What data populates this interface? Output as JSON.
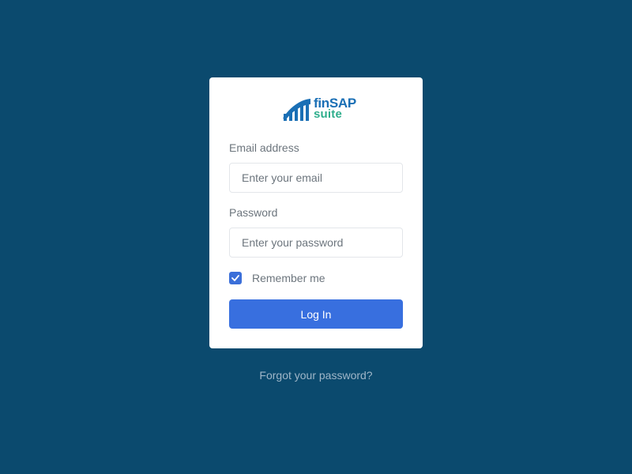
{
  "colors": {
    "background": "#0b4a6e",
    "card": "#ffffff",
    "primary": "#386fdf",
    "logo_blue": "#1a6fb5",
    "logo_green": "#2fae8c",
    "muted_text": "#6c757d",
    "link": "#9fb6c8"
  },
  "logo": {
    "brand_top": "finSAP",
    "brand_bottom": "suite",
    "icon": "bar-chart-logo-icon"
  },
  "form": {
    "email": {
      "label": "Email address",
      "placeholder": "Enter your email",
      "value": ""
    },
    "password": {
      "label": "Password",
      "placeholder": "Enter your password",
      "value": ""
    },
    "remember": {
      "label": "Remember me",
      "checked": true,
      "icon": "check-icon"
    },
    "submit_label": "Log In"
  },
  "footer": {
    "forgot_label": "Forgot your password?"
  }
}
